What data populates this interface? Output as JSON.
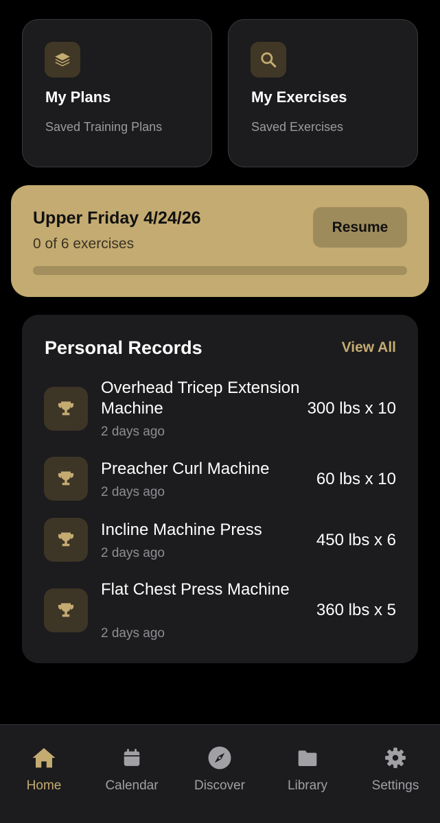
{
  "quick_actions": [
    {
      "title": "My Plans",
      "subtitle": "Saved Training Plans",
      "icon": "layers-icon"
    },
    {
      "title": "My Exercises",
      "subtitle": "Saved Exercises",
      "icon": "search-icon"
    }
  ],
  "active_workout": {
    "title": "Upper Friday 4/24/26",
    "progress_text": "0 of 6 exercises",
    "progress_fraction": 0,
    "resume_label": "Resume"
  },
  "personal_records": {
    "title": "Personal Records",
    "view_all_label": "View All",
    "items": [
      {
        "name": "Overhead Tricep Extension Machine",
        "time": "2 days ago",
        "value": "300 lbs x 10"
      },
      {
        "name": "Preacher Curl Machine",
        "time": "2 days ago",
        "value": "60 lbs x 10"
      },
      {
        "name": "Incline Machine Press",
        "time": "2 days ago",
        "value": "450 lbs x 6"
      },
      {
        "name": "Flat Chest Press Machine",
        "time": "2 days ago",
        "value": "360 lbs x 5"
      }
    ]
  },
  "tab_bar": {
    "items": [
      {
        "label": "Home",
        "icon": "home-icon",
        "active": true
      },
      {
        "label": "Calendar",
        "icon": "calendar-icon",
        "active": false
      },
      {
        "label": "Discover",
        "icon": "compass-icon",
        "active": false
      },
      {
        "label": "Library",
        "icon": "folder-icon",
        "active": false
      },
      {
        "label": "Settings",
        "icon": "gear-icon",
        "active": false
      }
    ]
  },
  "colors": {
    "accent": "#c4ab71",
    "background": "#000000",
    "card": "#1c1c1e",
    "muted_text": "#8e8e93"
  }
}
